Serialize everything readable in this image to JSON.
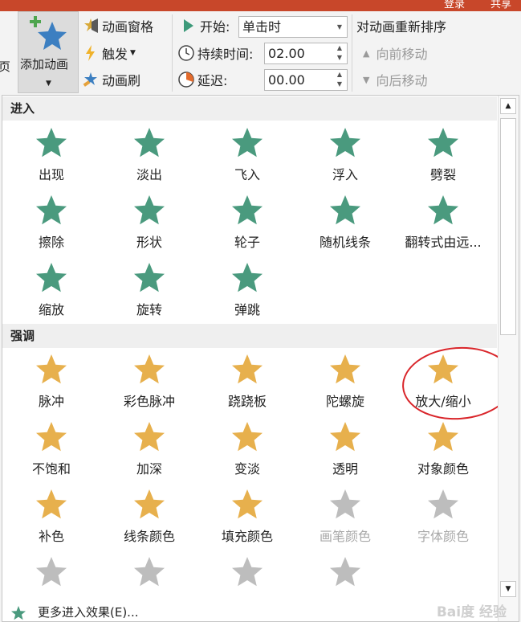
{
  "titlebar": {
    "text": "登录",
    "text2": "共享"
  },
  "ribbon": {
    "left_cut": "页",
    "add_animation": "添加动画",
    "anim_pane": "动画窗格",
    "trigger": "触发",
    "anim_painter": "动画刷",
    "start_label": "开始:",
    "start_value": "单击时",
    "duration_label": "持续时间:",
    "duration_value": "02.00",
    "delay_label": "延迟:",
    "delay_value": "00.00",
    "reorder_title": "对动画重新排序",
    "move_earlier": "向前移动",
    "move_later": "向后移动"
  },
  "gallery": {
    "entrance_header": "进入",
    "entrance": [
      {
        "name": "出现",
        "icon": "appear-star-icon"
      },
      {
        "name": "淡出",
        "icon": "fade-star-icon"
      },
      {
        "name": "飞入",
        "icon": "fly-in-star-icon"
      },
      {
        "name": "浮入",
        "icon": "float-in-star-icon"
      },
      {
        "name": "劈裂",
        "icon": "split-star-icon"
      },
      {
        "name": "擦除",
        "icon": "wipe-star-icon"
      },
      {
        "name": "形状",
        "icon": "shape-star-icon"
      },
      {
        "name": "轮子",
        "icon": "wheel-star-icon"
      },
      {
        "name": "随机线条",
        "icon": "random-bars-star-icon"
      },
      {
        "name": "翻转式由远...",
        "icon": "grow-turn-star-icon"
      },
      {
        "name": "缩放",
        "icon": "zoom-star-icon"
      },
      {
        "name": "旋转",
        "icon": "swivel-star-icon"
      },
      {
        "name": "弹跳",
        "icon": "bounce-star-icon"
      }
    ],
    "emphasis_header": "强调",
    "emphasis": [
      {
        "name": "脉冲",
        "icon": "pulse-star-icon",
        "gray": false
      },
      {
        "name": "彩色脉冲",
        "icon": "color-pulse-star-icon",
        "gray": false
      },
      {
        "name": "跷跷板",
        "icon": "teeter-star-icon",
        "gray": false
      },
      {
        "name": "陀螺旋",
        "icon": "spin-star-icon",
        "gray": false
      },
      {
        "name": "放大/缩小",
        "icon": "grow-shrink-star-icon",
        "gray": false
      },
      {
        "name": "不饱和",
        "icon": "desaturate-star-icon",
        "gray": false
      },
      {
        "name": "加深",
        "icon": "darken-star-icon",
        "gray": false
      },
      {
        "name": "变淡",
        "icon": "lighten-star-icon",
        "gray": false
      },
      {
        "name": "透明",
        "icon": "transparency-star-icon",
        "gray": false
      },
      {
        "name": "对象颜色",
        "icon": "object-color-star-icon",
        "gray": false
      },
      {
        "name": "补色",
        "icon": "complementary-color-star-icon",
        "gray": false
      },
      {
        "name": "线条颜色",
        "icon": "line-color-star-icon",
        "gray": false
      },
      {
        "name": "填充颜色",
        "icon": "fill-color-star-icon",
        "gray": false
      },
      {
        "name": "画笔颜色",
        "icon": "brush-color-star-icon",
        "gray": true
      },
      {
        "name": "字体颜色",
        "icon": "font-color-star-icon",
        "gray": true
      },
      {
        "name": "",
        "icon": "underline-star-icon",
        "gray": true
      },
      {
        "name": "",
        "icon": "bold-flash-star-icon",
        "gray": true
      },
      {
        "name": "",
        "icon": "bold-reveal-star-icon",
        "gray": true
      },
      {
        "name": "",
        "icon": "wave-star-icon",
        "gray": true
      }
    ],
    "more_entrance": "更多进入效果(E)..."
  },
  "watermark": "Bai度 经验",
  "colors": {
    "entrance_star": "#4a9a7e",
    "emphasis_star": "#e7b04d",
    "gray_star": "#bdbdbd",
    "circle": "#d9252a",
    "titlebar": "#c8472a"
  }
}
